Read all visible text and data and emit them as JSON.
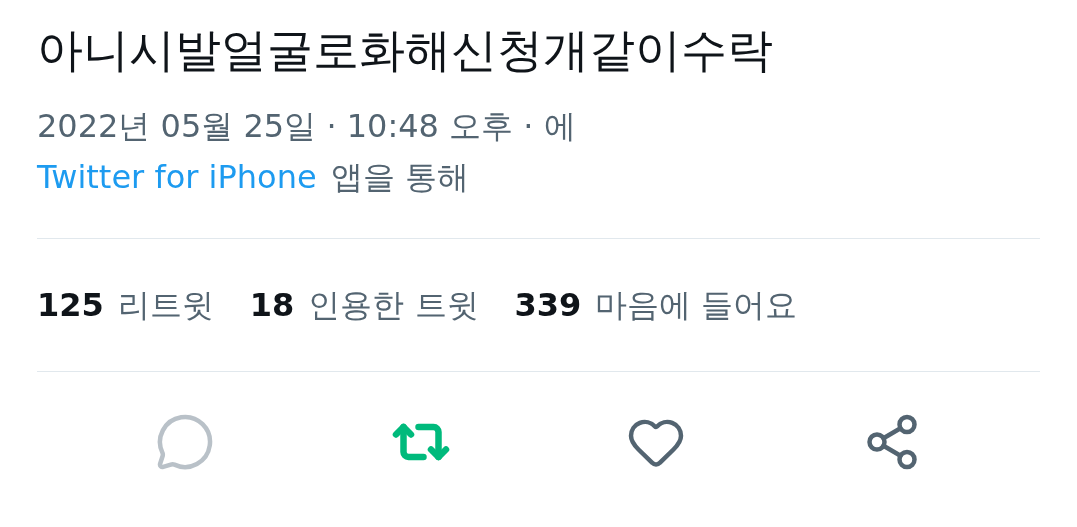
{
  "tweet": {
    "text": "아니시발얼굴로화해신청개같이수락",
    "timestamp": "2022년 05월 25일 · 10:48 오후 · 에",
    "source": "Twitter for iPhone",
    "source_suffix": "앱을 통해"
  },
  "stats": [
    {
      "count": "125",
      "label": "리트윗"
    },
    {
      "count": "18",
      "label": "인용한 트윗"
    },
    {
      "count": "339",
      "label": "마음에 들어요"
    }
  ],
  "actions": [
    {
      "kind": "reply",
      "disabled": true
    },
    {
      "kind": "retweet",
      "active": true
    },
    {
      "kind": "like",
      "active": false
    },
    {
      "kind": "share"
    }
  ]
}
